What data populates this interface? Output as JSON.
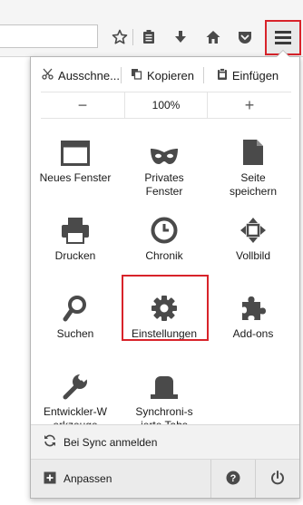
{
  "toolbar": {
    "icons": [
      "bookmark-star-icon",
      "reading-list-icon",
      "download-icon",
      "home-icon",
      "pocket-icon",
      "hamburger-menu-icon"
    ]
  },
  "edit": {
    "cut": "Ausschne...",
    "copy": "Kopieren",
    "paste": "Einfügen"
  },
  "zoom": {
    "minus": "−",
    "value": "100%",
    "plus": "+"
  },
  "grid": [
    {
      "label": "Neues Fenster",
      "icon": "new-window-icon"
    },
    {
      "label": "Privates Fenster",
      "icon": "private-mask-icon"
    },
    {
      "label": "Seite speichern",
      "icon": "save-page-icon"
    },
    {
      "label": "Drucken",
      "icon": "print-icon"
    },
    {
      "label": "Chronik",
      "icon": "history-clock-icon"
    },
    {
      "label": "Vollbild",
      "icon": "fullscreen-icon"
    },
    {
      "label": "Suchen",
      "icon": "search-icon"
    },
    {
      "label": "Einstellungen",
      "icon": "gear-icon"
    },
    {
      "label": "Add-ons",
      "icon": "puzzle-icon"
    },
    {
      "label": "Entwickler-Werkzeuge",
      "icon": "wrench-icon"
    },
    {
      "label": "Synchroni-sierte Tabs",
      "icon": "synced-tabs-icon"
    }
  ],
  "sync": {
    "label": "Bei Sync anmelden"
  },
  "footer": {
    "customize": "Anpassen"
  },
  "colors": {
    "highlight": "#d8232a",
    "icon": "#4a4a4a"
  }
}
